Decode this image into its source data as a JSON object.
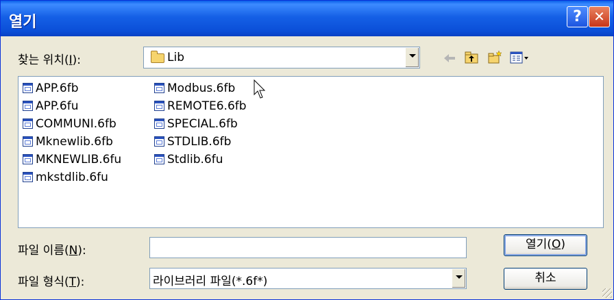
{
  "window": {
    "title": "열기",
    "help_glyph": "?",
    "close_glyph": "✕"
  },
  "lookin": {
    "label_pre": "찾는 위치(",
    "label_key": "I",
    "label_post": "):",
    "value": "Lib",
    "folder_icon": "folder-icon"
  },
  "toolbar": {
    "back_icon": "back-arrow-icon",
    "up_icon": "up-folder-icon",
    "new_icon": "new-folder-icon",
    "view_icon": "view-menu-icon"
  },
  "files": [
    "APP.6fb",
    "APP.6fu",
    "COMMUNI.6fb",
    "Mknewlib.6fb",
    "MKNEWLIB.6fu",
    "mkstdlib.6fu",
    "Modbus.6fb",
    "REMOTE6.6fb",
    "SPECIAL.6fb",
    "STDLIB.6fb",
    "Stdlib.6fu"
  ],
  "filename": {
    "label_pre": "파일 이름(",
    "label_key": "N",
    "label_post": "):",
    "value": ""
  },
  "filetype": {
    "label_pre": "파일 형식(",
    "label_key": "T",
    "label_post": "):",
    "value": "라이브러리 파일(*.6f*)"
  },
  "buttons": {
    "open_pre": "열기(",
    "open_key": "O",
    "open_post": ")",
    "cancel": "취소"
  },
  "colors": {
    "titlebar": "#0A5FE8",
    "dialog_bg": "#ECE9D8"
  }
}
